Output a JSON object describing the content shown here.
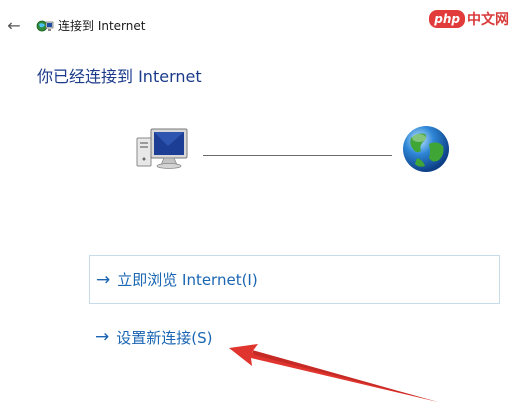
{
  "window": {
    "title": "连接到 Internet",
    "back_icon": "←"
  },
  "watermark": {
    "badge": "php",
    "text": "中文网"
  },
  "main": {
    "heading": "你已经连接到 Internet"
  },
  "commands": {
    "arrow": "→",
    "browse_label": "立即浏览 Internet(I)",
    "setup_label": "设置新连接(S)"
  },
  "colors": {
    "heading": "#1b3a8a",
    "link": "#1a66b3",
    "link_border": "#c7dbe9",
    "annotation": "#e0352f"
  },
  "icons": {
    "back": "back-arrow-icon",
    "wizard": "network-wizard-icon",
    "computer": "computer-icon",
    "globe": "internet-globe-icon"
  }
}
